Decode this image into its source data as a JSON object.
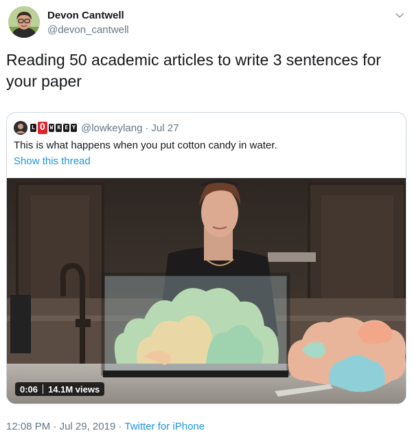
{
  "author": {
    "name": "Devon Cantwell",
    "handle": "@devon_cantwell"
  },
  "tweet": {
    "text": "Reading 50 academic articles to write 3 sentences for your paper"
  },
  "quoted_tweet": {
    "logo_letters": [
      "L",
      "O",
      "W",
      "K",
      "E",
      "Y"
    ],
    "handle": "@lowkeylang",
    "separator": "·",
    "date": "Jul 27",
    "text": "This is what happens when you put cotton candy in water.",
    "show_thread_label": "Show this thread",
    "video": {
      "duration": "0:06",
      "views": "14.1M views"
    }
  },
  "footer": {
    "time": "12:08 PM",
    "sep1": "·",
    "date": "Jul 29, 2019",
    "sep2": "·",
    "source": "Twitter for iPhone"
  },
  "colors": {
    "link": "#1b95e0",
    "secondary_text": "#657786",
    "border": "#ccd6dd",
    "logo_red": "#e0242b"
  },
  "icons": [
    "avatar",
    "chevron-down-icon",
    "quoted-avatar",
    "lowkey-logo"
  ]
}
